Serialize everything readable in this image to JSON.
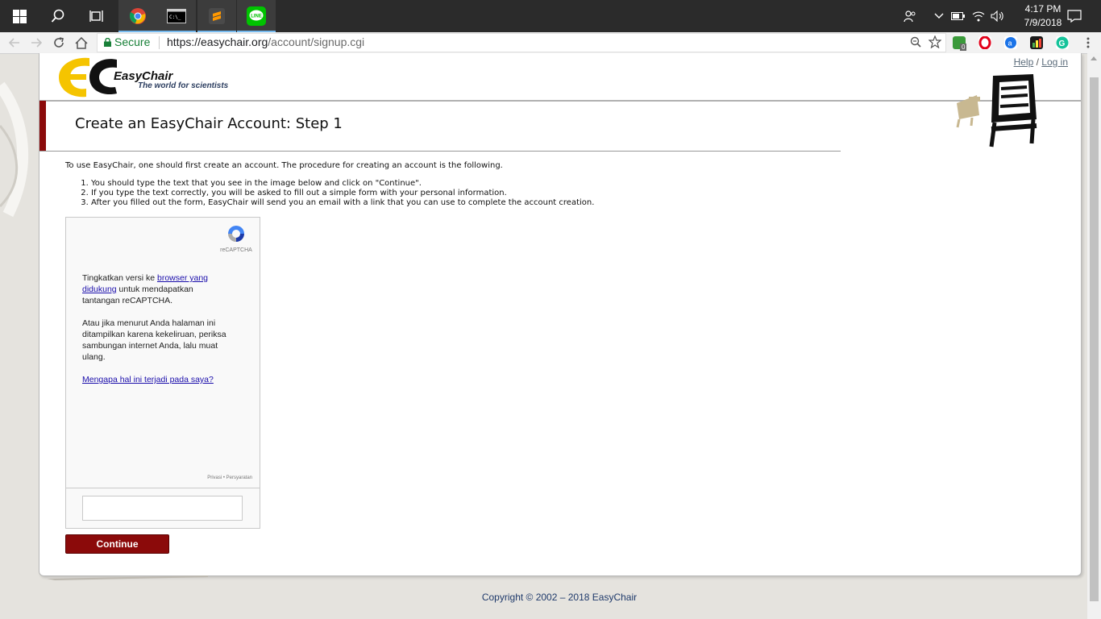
{
  "taskbar": {
    "apps": [
      "start-button",
      "search-button",
      "task-view-button",
      "chrome",
      "terminal",
      "sublime-text",
      "line"
    ],
    "clock": {
      "time": "4:17 PM",
      "date": "7/9/2018"
    }
  },
  "browser": {
    "secure_label": "Secure",
    "url_host": "https://easychair.org",
    "url_path": "/account/signup.cgi",
    "extension_badge": "0"
  },
  "header": {
    "brand": "EasyChair",
    "tagline": "The world for scientists",
    "help_label": "Help",
    "separator": "/",
    "login_label": "Log in"
  },
  "main": {
    "title": "Create an EasyChair Account: Step 1",
    "intro": "To use EasyChair, one should first create an account. The procedure for creating an account is the following.",
    "steps": [
      "You should type the text that you see in the image below and click on \"Continue\".",
      "If you type the text correctly, you will be asked to fill out a simple form with your personal information.",
      "After you filled out the form, EasyChair will send you an email with a link that you can use to complete the account creation."
    ]
  },
  "recaptcha": {
    "logo_label": "reCAPTCHA",
    "msg1_pre": "Tingkatkan versi ke ",
    "msg1_link": "browser yang didukung",
    "msg1_post": " untuk mendapatkan tantangan reCAPTCHA.",
    "msg2": "Atau jika menurut Anda halaman ini ditampilkan karena kekeliruan, periksa sambungan internet Anda, lalu muat ulang.",
    "why_link": "Mengapa hal ini terjadi pada saya?",
    "footer": "Privasi • Persyaratan"
  },
  "form": {
    "answer_value": "",
    "continue_label": "Continue"
  },
  "footer": {
    "copyright": "Copyright © 2002 – 2018 EasyChair"
  },
  "colors": {
    "accent_red": "#8b0a0a",
    "taskbar": "#2b2b2b",
    "link_blue": "#1a0dab",
    "secure_green": "#188038"
  }
}
